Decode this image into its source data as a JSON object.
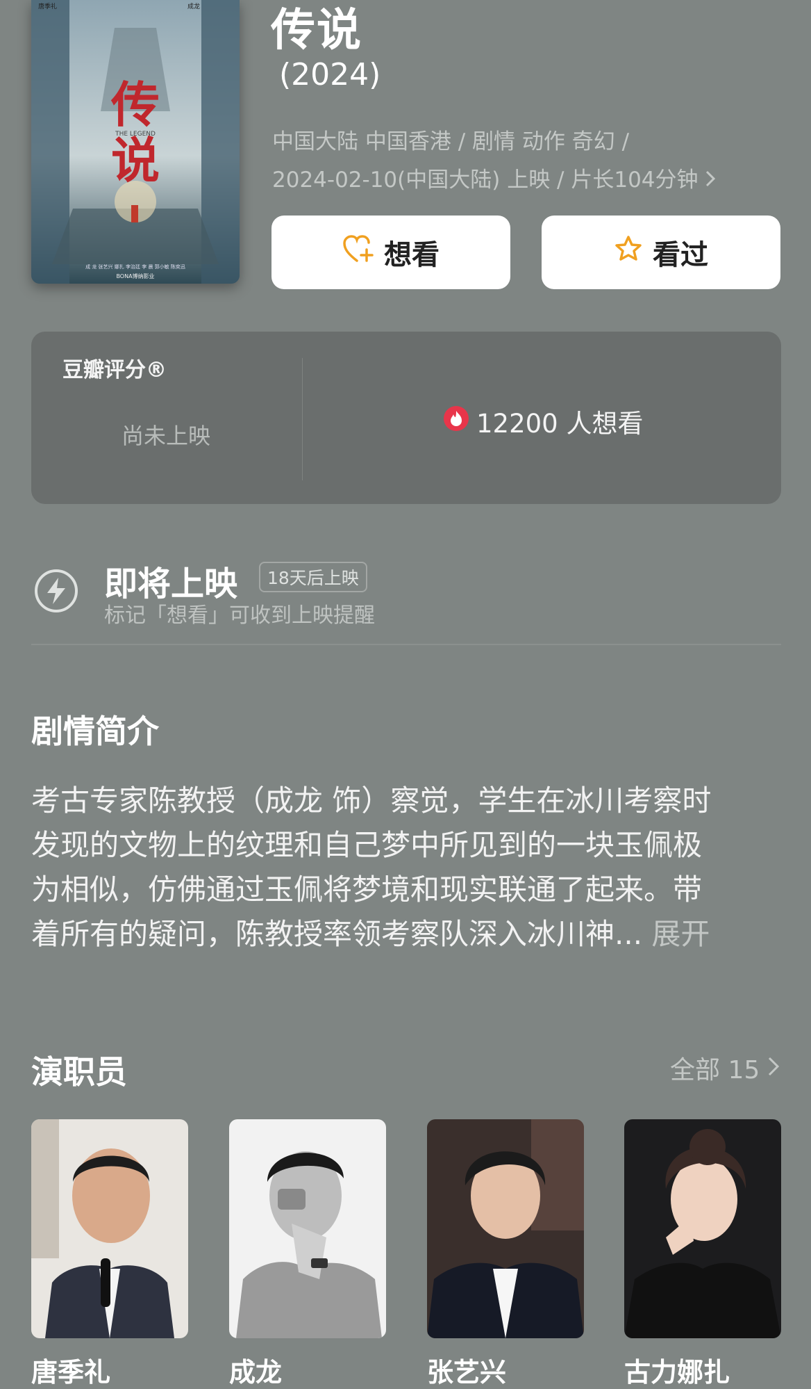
{
  "movie": {
    "title": "传说",
    "year": "(2024)",
    "meta_line1": "中国大陆 中国香港 / 剧情 动作 奇幻 /",
    "meta_line2": "2024-02-10(中国大陆) 上映 / 片长104分钟",
    "poster": {
      "title_text": "传说",
      "subtitle": "THE LEGEND",
      "top_names": [
        "唐季礼",
        "成龙"
      ],
      "credits": "成 龙  张艺兴  娜扎  李治廷  李 晨  郭小敏  陈奕迅",
      "studio": "BONA博纳影业"
    }
  },
  "actions": {
    "want_label": "想看",
    "seen_label": "看过"
  },
  "rating": {
    "label": "豆瓣评分®",
    "status": "尚未上映",
    "want_count": "12200 人想看"
  },
  "upcoming": {
    "title": "即将上映",
    "badge": "18天后上映",
    "subtitle": "标记「想看」可收到上映提醒"
  },
  "synopsis": {
    "title": "剧情简介",
    "lines": [
      "考古专家陈教授（成龙 饰）察觉，学生在冰川考察时",
      "发现的文物上的纹理和自己梦中所见到的一块玉佩极",
      "为相似，仿佛通过玉佩将梦境和现实联通了起来。带",
      "着所有的疑问，陈教授率领考察队深入冰川神..."
    ],
    "expand_label": "展开"
  },
  "cast": {
    "title": "演职员",
    "all_label": "全部 15",
    "members": [
      {
        "name": "唐季礼"
      },
      {
        "name": "成龙"
      },
      {
        "name": "张艺兴"
      },
      {
        "name": "古力娜扎"
      }
    ]
  },
  "colors": {
    "background": "#7f8583",
    "card": "#6a6e6d",
    "accent_orange": "#f0a020",
    "flame_red": "#e8354a"
  }
}
